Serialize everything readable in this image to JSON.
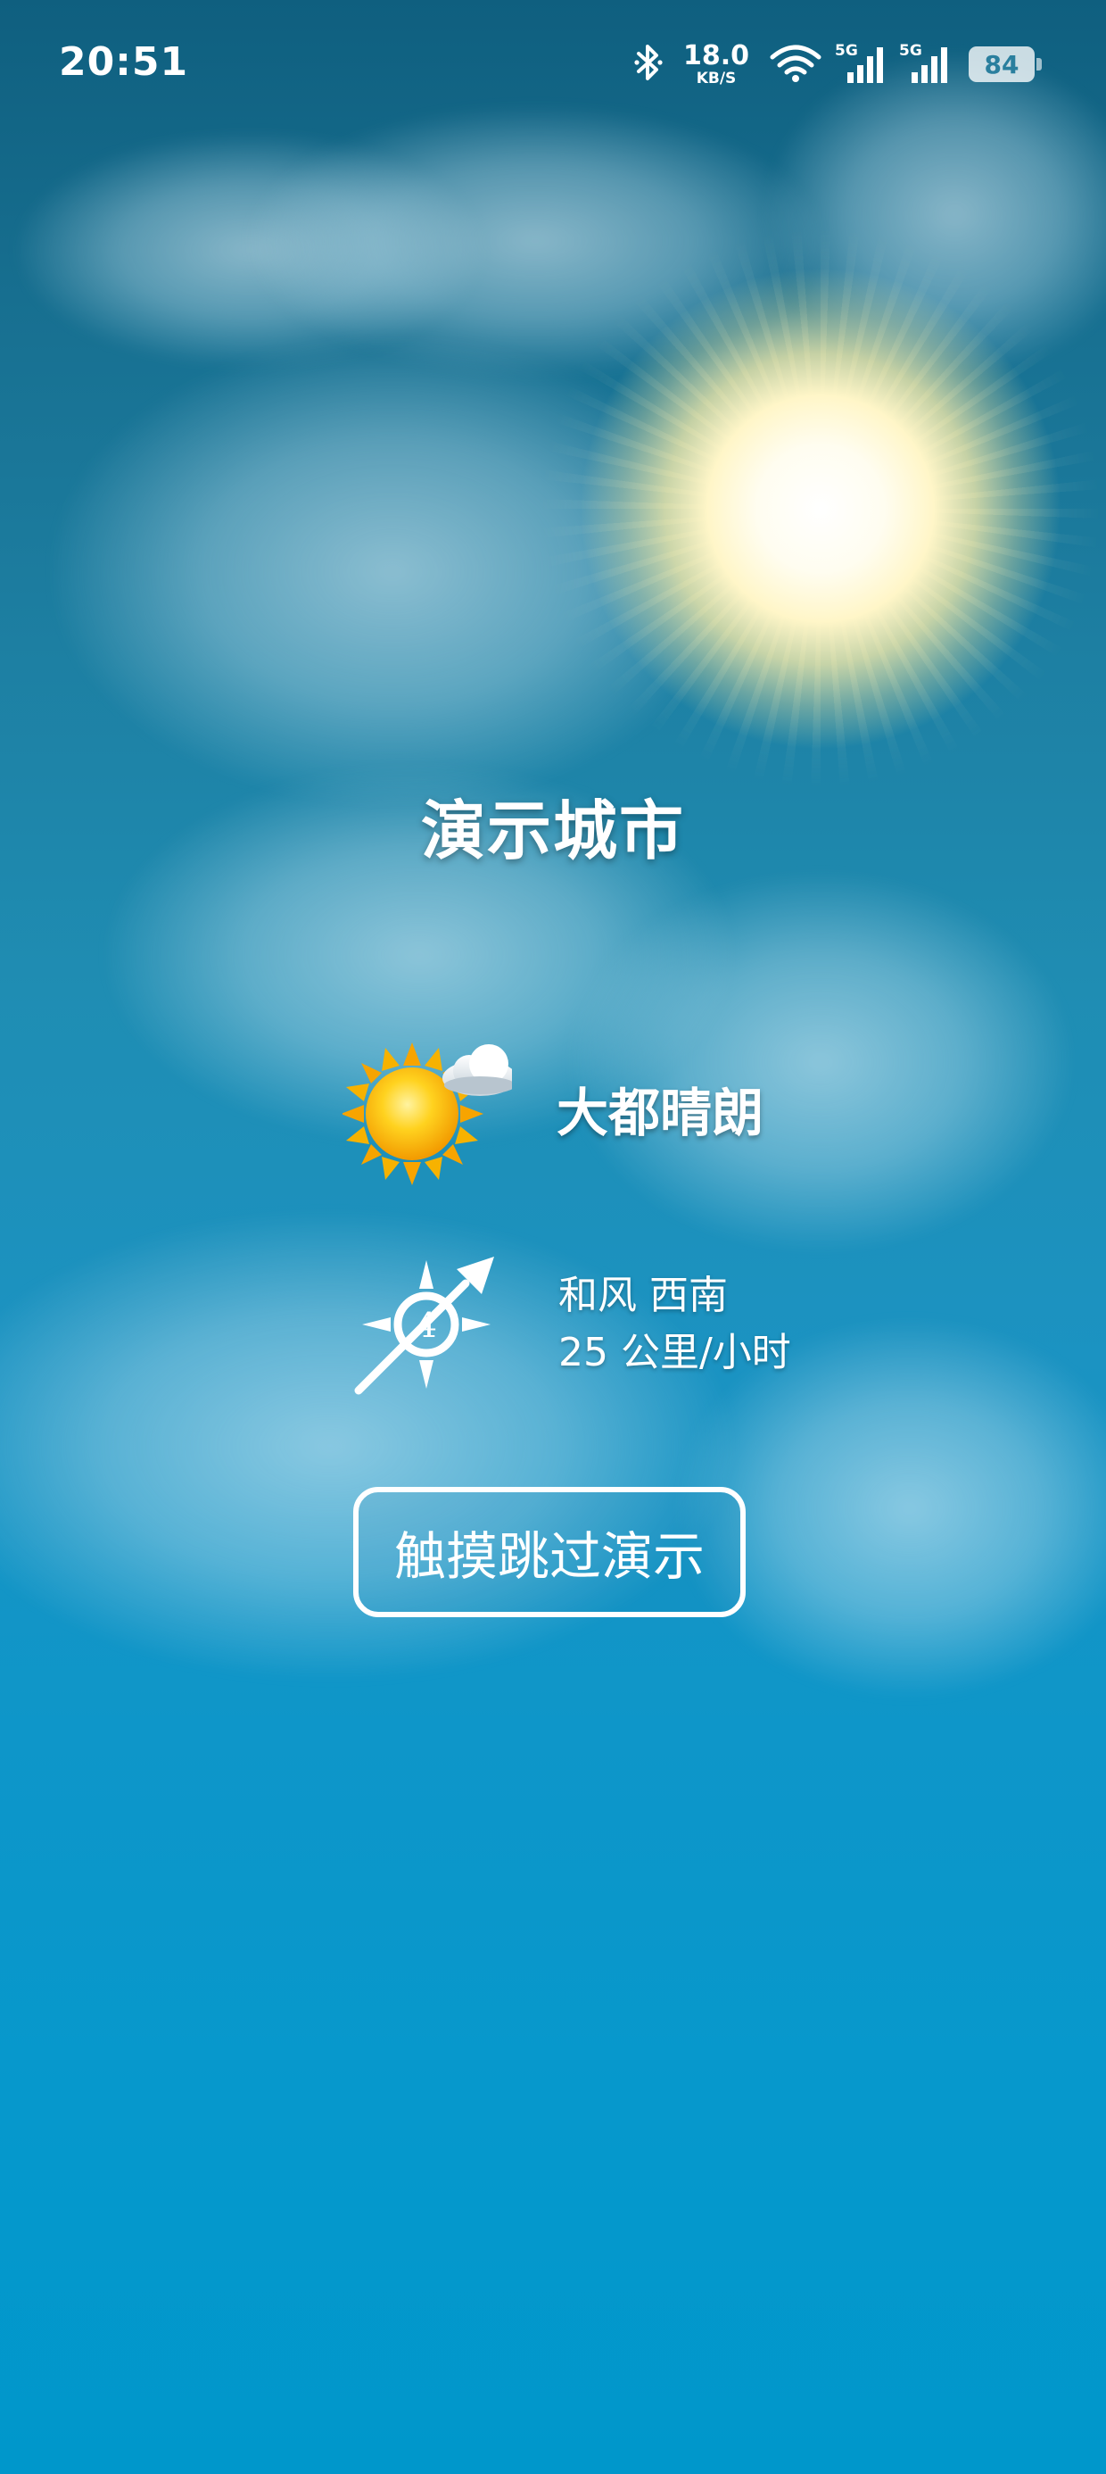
{
  "status_bar": {
    "time": "20:51",
    "net_speed_value": "18.0",
    "net_speed_unit": "KB/S",
    "signal_1_label": "5G",
    "signal_2_label": "5G",
    "battery_level": "84",
    "icons": [
      "bluetooth-icon",
      "wifi-icon",
      "signal-icon",
      "signal-icon",
      "battery-icon"
    ]
  },
  "main": {
    "city": "演示城市",
    "condition": "大都晴朗",
    "condition_icon": "sun-cloud-icon",
    "wind_line_1": "和风 西南",
    "wind_line_2": "25 公里/小时",
    "wind_icon": "wind-compass-icon",
    "wind_level": "4",
    "skip_button_label": "触摸跳过演示"
  },
  "colors": {
    "sky_top": "#0f5f7f",
    "sky_bottom": "#0097cb",
    "text": "#ffffff",
    "sun_core": "#fff6c8"
  }
}
